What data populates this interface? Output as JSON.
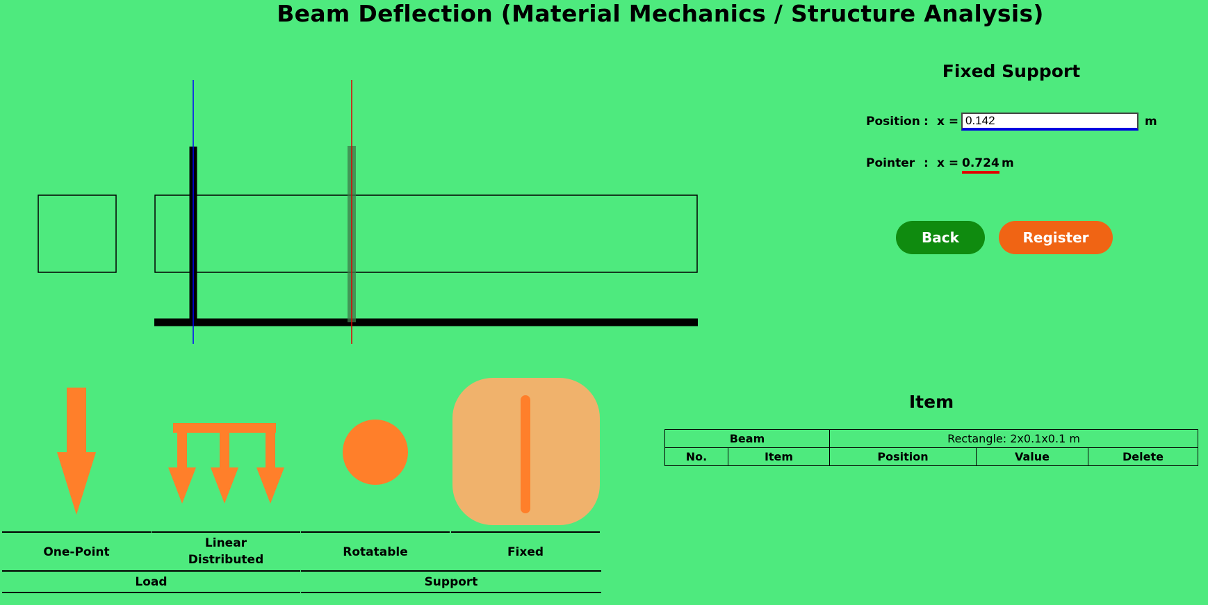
{
  "title": "Beam Deflection (Material Mechanics / Structure Analysis)",
  "panel": {
    "title": "Fixed Support",
    "position_label": "Position",
    "colon": ":",
    "x_eq": "x =",
    "position_value": "0.142",
    "unit": "m",
    "pointer_label": "Pointer",
    "pointer_value": "0.724",
    "back_label": "Back",
    "register_label": "Register"
  },
  "palette": {
    "items": [
      {
        "label": "One-Point"
      },
      {
        "label": "Linear Distributed"
      },
      {
        "label": "Rotatable"
      },
      {
        "label": "Fixed"
      }
    ],
    "groups": [
      {
        "label": "Load"
      },
      {
        "label": "Support"
      }
    ]
  },
  "items": {
    "title": "Item",
    "beam_label": "Beam",
    "beam_value": "Rectangle: 2x0.1x0.1 m",
    "columns": [
      "No.",
      "Item",
      "Position",
      "Value",
      "Delete"
    ]
  },
  "colors": {
    "background": "#4eea7e",
    "orange": "#ff7f2a",
    "light_orange": "#f0b26c",
    "back": "#0f8b0f",
    "register": "#f06414",
    "position_line": "#0000ff",
    "pointer_line": "#e00000"
  }
}
